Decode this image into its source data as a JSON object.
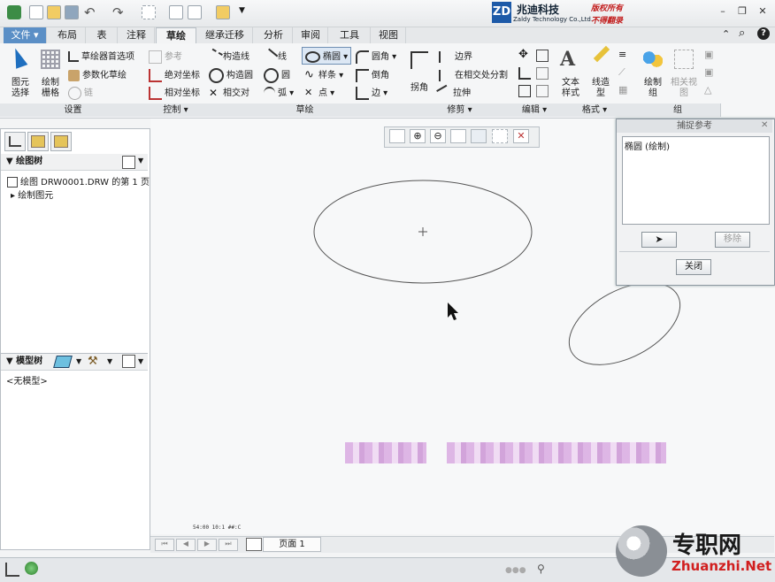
{
  "brand": {
    "logo_letters": "ZD",
    "name_cn": "兆迪科技",
    "name_en": "Zaldy Technology Co.,Ltd.",
    "copyright_1": "版权所有",
    "copyright_2": "不得翻录"
  },
  "tabs": [
    "文件",
    "布局",
    "表",
    "注释",
    "草绘",
    "继承迁移",
    "分析",
    "审阅",
    "工具",
    "视图"
  ],
  "active_tab": "草绘",
  "ribbon": {
    "setup": {
      "pick": "图元\n选择",
      "grid": "绘制\n栅格",
      "prefs": "草绘器首选项",
      "param": "参数化草绘",
      "chain": "链",
      "label": "设置"
    },
    "control": {
      "ref": "参考",
      "abs": "绝对坐标",
      "rel": "相对坐标",
      "label": "控制"
    },
    "sketch": {
      "cline": "构造线",
      "ccircle": "构造圆",
      "cross": "相交对",
      "line": "线",
      "circle": "圆",
      "arc": "弧",
      "ellipse": "椭圆",
      "spline": "样条",
      "point": "点",
      "fillet": "圆角",
      "chamfer": "倒角",
      "edge": "边",
      "label": "草绘"
    },
    "trim": {
      "corner": "拐角",
      "boundary": "边界",
      "divide": "在相交处分割",
      "stretch": "拉伸",
      "label": "修剪"
    },
    "edit": {
      "label": "编辑"
    },
    "format": {
      "text": "文本\n样式",
      "linestyle": "线造\n型",
      "label": "格式"
    },
    "group": {
      "draw": "绘制\n组",
      "related": "相关视\n图",
      "label": "组"
    }
  },
  "left_panel": {
    "drawing_tree": "绘图树",
    "drawing_item": "绘图 DRW0001.DRW 的第 1 页",
    "draw_entities": "绘制图元",
    "model_tree": "模型树",
    "no_model": "<无模型>"
  },
  "dialog": {
    "title": "捕捉参考",
    "item": "椭圆 (绘制)",
    "remove": "移除",
    "close": "关闭"
  },
  "page_tab": "页面 1",
  "coord_readout": "54:00  10:1  ##:C",
  "watermark": {
    "cn": "专职网",
    "url": "Zhuanzhi.Net"
  }
}
